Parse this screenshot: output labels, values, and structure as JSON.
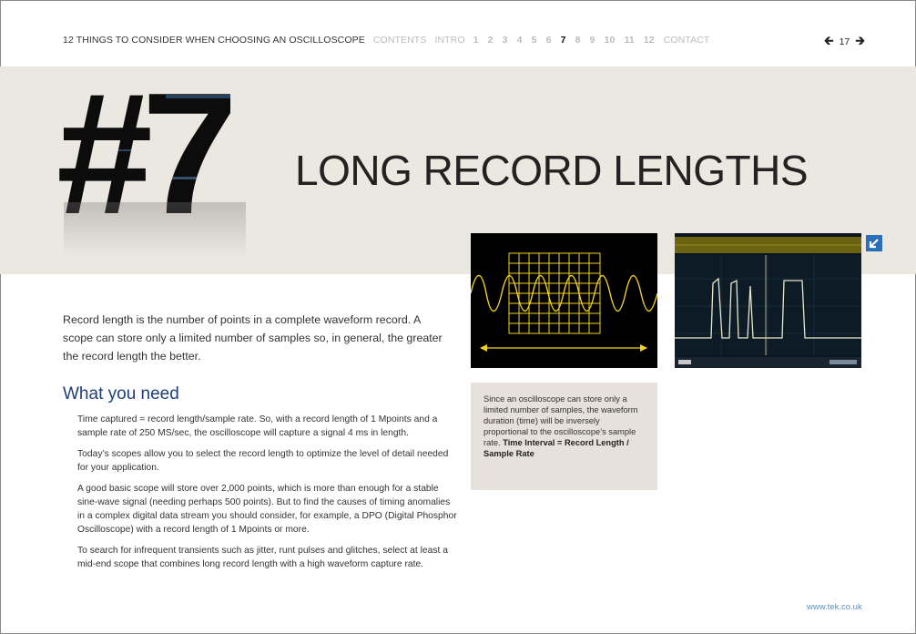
{
  "nav": {
    "doc_title": "12 THINGS TO CONSIDER WHEN CHOOSING AN OSCILLOSCOPE",
    "contents": "CONTENTS",
    "intro": "INTRO",
    "numbers": [
      "1",
      "2",
      "3",
      "4",
      "5",
      "6",
      "7",
      "8",
      "9",
      "10",
      "11",
      "12"
    ],
    "active_number": "7",
    "contact": "CONTACT"
  },
  "pager": {
    "prev_icon": "arrow-left-icon",
    "page": "17",
    "next_icon": "arrow-right-icon"
  },
  "section": {
    "number": "#7",
    "title": "LONG RECORD LENGTHS"
  },
  "intro_text": "Record length is the number of points in a complete waveform record. A scope can store only a limited number of samples so, in general, the greater the record length the better.",
  "what_you_need": {
    "heading": "What you need",
    "paragraphs": [
      "Time captured = record length/sample rate. So, with a record length of 1 Mpoints and a sample rate of 250 MS/sec, the oscilloscope will capture a signal 4 ms in length.",
      "Today’s scopes allow you to select the record length to optimize the level of detail needed for your application.",
      "A good basic scope will store over 2,000 points, which is more than enough for a stable sine-wave signal (needing perhaps 500 points). But to find the causes of timing anomalies in a complex digital data stream you should consider, for example, a DPO (Digital Phosphor Oscilloscope) with a record length of 1 Mpoints or more.",
      "To search for infrequent transients such as jitter, runt pulses and glitches, select at least a mid-end scope that combines long record length with a high waveform capture rate."
    ]
  },
  "caption": {
    "text": "Since an oscilloscope can store only a limited number of samples, the waveform duration (time) will be inversely proportional to the oscilloscope’s sample rate.",
    "formula": "Time Interval = Record Length / Sample Rate"
  },
  "footer": {
    "url": "www.tek.co.uk"
  },
  "colors": {
    "band": "#ebe7e1",
    "heading_blue": "#1f3f78",
    "waveform_yellow": "#f2d21b",
    "accent_blue": "#2a6fb7",
    "link_blue": "#5a8fc4"
  },
  "icons": {
    "expand": "expand-arrow-icon"
  }
}
